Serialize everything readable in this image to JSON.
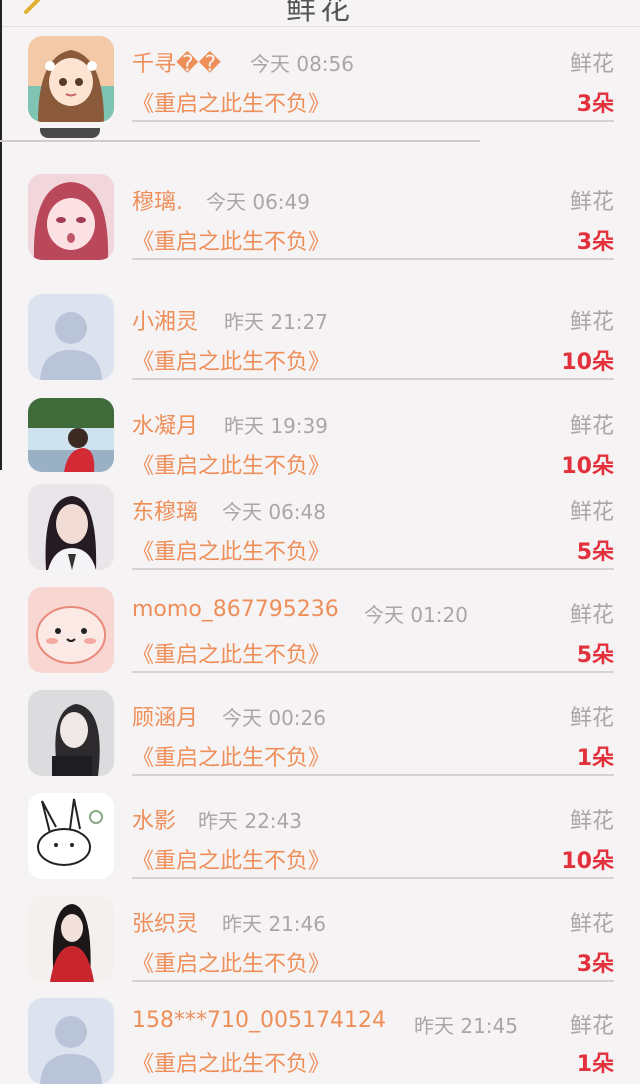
{
  "header": {
    "title": "鲜花"
  },
  "colors": {
    "name": "#ee8f5a",
    "count": "#e2303c",
    "muted": "#a9a6a7"
  },
  "entries": [
    {
      "name": "千寻��",
      "time": "今天 08:56",
      "book": "《重启之此生不负》",
      "type": "鲜花",
      "count": "3朵",
      "avatar": "anime-girl-icon"
    },
    {
      "name": "穆璃.",
      "time": "今天 06:49",
      "book": "《重启之此生不负》",
      "type": "鲜花",
      "count": "3朵",
      "avatar": "anime-girl-pink-icon"
    },
    {
      "name": "小湘灵",
      "time": "昨天 21:27",
      "book": "《重启之此生不负》",
      "type": "鲜花",
      "count": "10朵",
      "avatar": "default-avatar-icon"
    },
    {
      "name": "水凝月",
      "time": "昨天 19:39",
      "book": "《重启之此生不负》",
      "type": "鲜花",
      "count": "10朵",
      "avatar": "couple-photo-icon"
    },
    {
      "name": "东穆璃",
      "time": "今天 06:48",
      "book": "《重启之此生不负》",
      "type": "鲜花",
      "count": "5朵",
      "avatar": "woman-portrait-icon"
    },
    {
      "name": "momo_867795236",
      "time": "今天 01:20",
      "book": "《重启之此生不负》",
      "type": "鲜花",
      "count": "5朵",
      "avatar": "pink-cartoon-icon"
    },
    {
      "name": "顾涵月",
      "time": "今天 00:26",
      "book": "《重启之此生不负》",
      "type": "鲜花",
      "count": "1朵",
      "avatar": "woman-bw-portrait-icon"
    },
    {
      "name": "水影",
      "time": "昨天 22:43",
      "book": "《重启之此生不负》",
      "type": "鲜花",
      "count": "10朵",
      "avatar": "rabbit-sketch-icon"
    },
    {
      "name": "张织灵",
      "time": "昨天 21:46",
      "book": "《重启之此生不负》",
      "type": "鲜花",
      "count": "3朵",
      "avatar": "girl-red-dress-icon"
    },
    {
      "name": "158***710_005174124",
      "time": "昨天 21:45",
      "book": "《重启之此生不负》",
      "type": "鲜花",
      "count": "1朵",
      "avatar": "default-avatar-icon"
    }
  ]
}
